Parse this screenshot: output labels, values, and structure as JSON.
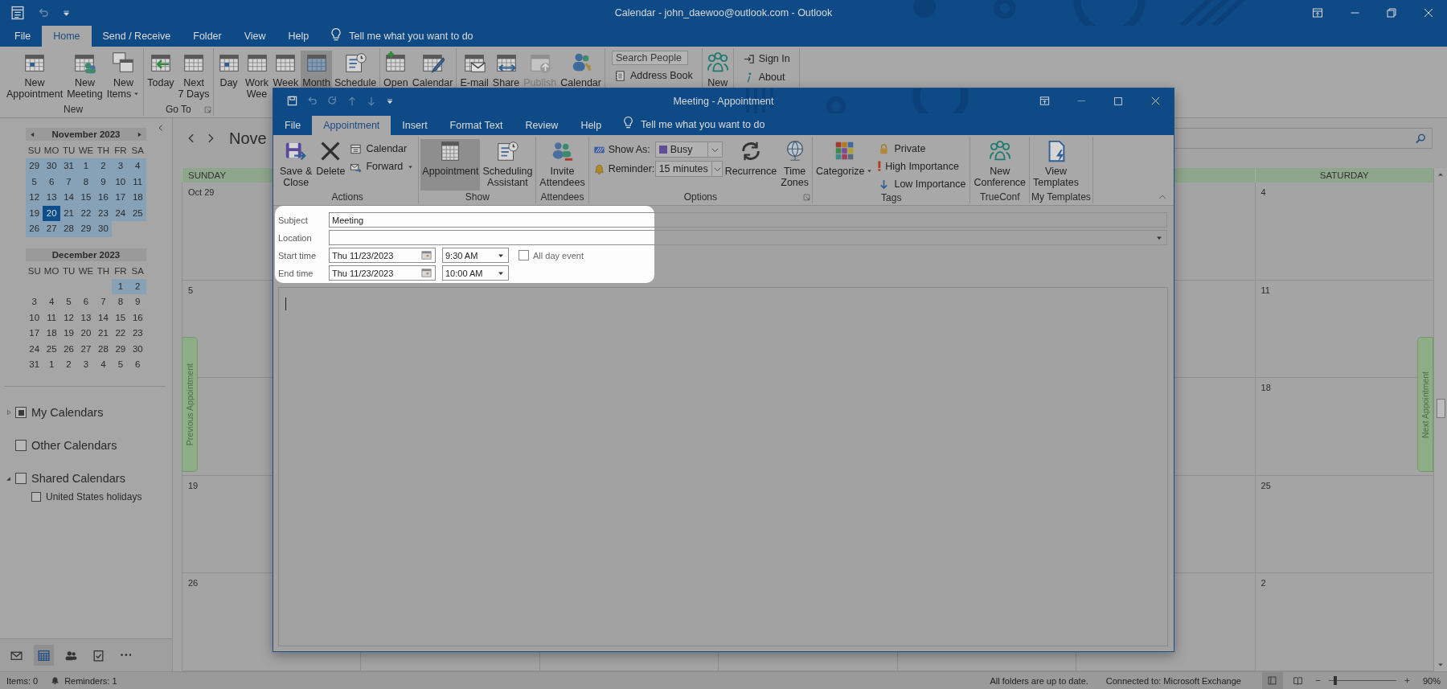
{
  "window": {
    "title": "Calendar - john_daewoo@outlook.com  -  Outlook"
  },
  "tabs": [
    {
      "label": "File",
      "selected": false
    },
    {
      "label": "Home",
      "selected": true
    },
    {
      "label": "Send / Receive",
      "selected": false
    },
    {
      "label": "Folder",
      "selected": false
    },
    {
      "label": "View",
      "selected": false
    },
    {
      "label": "Help",
      "selected": false
    }
  ],
  "tell_me": "Tell me what you want to do",
  "ribbon": {
    "groups": [
      {
        "kind": "large",
        "label": "New",
        "launcher": false,
        "buttons": [
          {
            "label": "New\nAppointment",
            "dropdown": false,
            "disabled": false,
            "selected": false
          },
          {
            "label": "New\nMeeting",
            "dropdown": false,
            "disabled": false,
            "selected": false
          },
          {
            "label": "New\nItems",
            "dropdown": true,
            "disabled": false,
            "selected": false
          }
        ]
      },
      {
        "kind": "large",
        "label": "Go To",
        "launcher": true,
        "buttons": [
          {
            "label": "Today",
            "dropdown": false,
            "disabled": false,
            "selected": false
          },
          {
            "label": "Next\n7 Days",
            "dropdown": false,
            "disabled": false,
            "selected": false
          }
        ]
      },
      {
        "kind": "large",
        "launcher": false,
        "buttons": [
          {
            "label": "Day",
            "dropdown": false,
            "disabled": false,
            "selected": false
          },
          {
            "label": "Work\nWee",
            "dropdown": false,
            "disabled": false,
            "selected": false
          },
          {
            "label": "Week",
            "dropdown": false,
            "disabled": false,
            "selected": false
          },
          {
            "label": "Month",
            "dropdown": false,
            "disabled": false,
            "selected": true
          },
          {
            "label": "Schedule",
            "dropdown": false,
            "disabled": false,
            "selected": false
          }
        ]
      },
      {
        "kind": "large",
        "launcher": false,
        "buttons": [
          {
            "label": "Open",
            "dropdown": false,
            "disabled": false,
            "selected": false
          },
          {
            "label": "Calendar",
            "dropdown": false,
            "disabled": false,
            "selected": false
          }
        ]
      },
      {
        "kind": "large",
        "launcher": false,
        "buttons": [
          {
            "label": "E-mail",
            "dropdown": false,
            "disabled": false,
            "selected": false
          },
          {
            "label": "Share",
            "dropdown": false,
            "disabled": false,
            "selected": false
          },
          {
            "label": "Publish",
            "dropdown": false,
            "disabled": true,
            "selected": false
          },
          {
            "label": "Calendar",
            "dropdown": false,
            "disabled": false,
            "selected": false
          }
        ]
      },
      {
        "kind": "find",
        "placeholder": "Search People",
        "button": "Address Book"
      },
      {
        "kind": "large",
        "launcher": false,
        "buttons": [
          {
            "label": "New",
            "dropdown": false,
            "disabled": false,
            "selected": false
          }
        ]
      },
      {
        "kind": "small",
        "buttons": [
          {
            "label": "Sign In"
          },
          {
            "label": "About"
          }
        ]
      }
    ]
  },
  "mini_calendars": [
    {
      "month": "November 2023",
      "arrows": true,
      "weekdays": [
        "SU",
        "MO",
        "TU",
        "WE",
        "TH",
        "FR",
        "SA"
      ],
      "weeks": [
        [
          {
            "day": "29",
            "in_view": true,
            "today": false
          },
          {
            "day": "30",
            "in_view": true,
            "today": false
          },
          {
            "day": "31",
            "in_view": true,
            "today": false
          },
          {
            "day": "1",
            "in_view": true,
            "today": false
          },
          {
            "day": "2",
            "in_view": true,
            "today": false
          },
          {
            "day": "3",
            "in_view": true,
            "today": false
          },
          {
            "day": "4",
            "in_view": true,
            "today": false
          }
        ],
        [
          {
            "day": "5",
            "in_view": true,
            "today": false
          },
          {
            "day": "6",
            "in_view": true,
            "today": false
          },
          {
            "day": "7",
            "in_view": true,
            "today": false
          },
          {
            "day": "8",
            "in_view": true,
            "today": false
          },
          {
            "day": "9",
            "in_view": true,
            "today": false
          },
          {
            "day": "10",
            "in_view": true,
            "today": false
          },
          {
            "day": "11",
            "in_view": true,
            "today": false
          }
        ],
        [
          {
            "day": "12",
            "in_view": true,
            "today": false
          },
          {
            "day": "13",
            "in_view": true,
            "today": false
          },
          {
            "day": "14",
            "in_view": true,
            "today": false
          },
          {
            "day": "15",
            "in_view": true,
            "today": false
          },
          {
            "day": "16",
            "in_view": true,
            "today": false
          },
          {
            "day": "17",
            "in_view": true,
            "today": false
          },
          {
            "day": "18",
            "in_view": true,
            "today": false
          }
        ],
        [
          {
            "day": "19",
            "in_view": true,
            "today": false
          },
          {
            "day": "20",
            "in_view": true,
            "today": true
          },
          {
            "day": "21",
            "in_view": true,
            "today": false
          },
          {
            "day": "22",
            "in_view": true,
            "today": false
          },
          {
            "day": "23",
            "in_view": true,
            "today": false
          },
          {
            "day": "24",
            "in_view": true,
            "today": false
          },
          {
            "day": "25",
            "in_view": true,
            "today": false
          }
        ],
        [
          {
            "day": "26",
            "in_view": true,
            "today": false
          },
          {
            "day": "27",
            "in_view": true,
            "today": false
          },
          {
            "day": "28",
            "in_view": true,
            "today": false
          },
          {
            "day": "29",
            "in_view": true,
            "today": false
          },
          {
            "day": "30",
            "in_view": true,
            "today": false
          }
        ]
      ]
    },
    {
      "month": "December 2023",
      "arrows": false,
      "weekdays": [
        "SU",
        "MO",
        "TU",
        "WE",
        "TH",
        "FR",
        "SA"
      ],
      "weeks": [
        [
          {
            "day": "1",
            "in_view": true,
            "today": false
          },
          {
            "day": "2",
            "in_view": true,
            "today": false
          }
        ],
        [
          {
            "day": "3",
            "in_view": false,
            "today": false
          },
          {
            "day": "4",
            "in_view": false,
            "today": false
          },
          {
            "day": "5",
            "in_view": false,
            "today": false
          },
          {
            "day": "6",
            "in_view": false,
            "today": false
          },
          {
            "day": "7",
            "in_view": false,
            "today": false
          },
          {
            "day": "8",
            "in_view": false,
            "today": false
          },
          {
            "day": "9",
            "in_view": false,
            "today": false
          }
        ],
        [
          {
            "day": "10",
            "in_view": false,
            "today": false
          },
          {
            "day": "11",
            "in_view": false,
            "today": false
          },
          {
            "day": "12",
            "in_view": false,
            "today": false
          },
          {
            "day": "13",
            "in_view": false,
            "today": false
          },
          {
            "day": "14",
            "in_view": false,
            "today": false
          },
          {
            "day": "15",
            "in_view": false,
            "today": false
          },
          {
            "day": "16",
            "in_view": false,
            "today": false
          }
        ],
        [
          {
            "day": "17",
            "in_view": false,
            "today": false
          },
          {
            "day": "18",
            "in_view": false,
            "today": false
          },
          {
            "day": "19",
            "in_view": false,
            "today": false
          },
          {
            "day": "20",
            "in_view": false,
            "today": false
          },
          {
            "day": "21",
            "in_view": false,
            "today": false
          },
          {
            "day": "22",
            "in_view": false,
            "today": false
          },
          {
            "day": "23",
            "in_view": false,
            "today": false
          }
        ],
        [
          {
            "day": "24",
            "in_view": false,
            "today": false
          },
          {
            "day": "25",
            "in_view": false,
            "today": false
          },
          {
            "day": "26",
            "in_view": false,
            "today": false
          },
          {
            "day": "27",
            "in_view": false,
            "today": false
          },
          {
            "day": "28",
            "in_view": false,
            "today": false
          },
          {
            "day": "29",
            "in_view": false,
            "today": false
          },
          {
            "day": "30",
            "in_view": false,
            "today": false
          }
        ],
        [
          {
            "day": "31",
            "in_view": false,
            "today": false
          },
          {
            "day": "1",
            "in_view": false,
            "today": false
          },
          {
            "day": "2",
            "in_view": false,
            "today": false
          },
          {
            "day": "3",
            "in_view": false,
            "today": false
          },
          {
            "day": "4",
            "in_view": false,
            "today": false
          },
          {
            "day": "5",
            "in_view": false,
            "today": false
          },
          {
            "day": "6",
            "in_view": false,
            "today": false
          }
        ]
      ]
    }
  ],
  "folders": [
    {
      "label": "My Calendars",
      "checked": true,
      "expandable": true,
      "expanded": false
    },
    {
      "label": "Other Calendars",
      "checked": false,
      "expandable": false
    },
    {
      "label": "Shared Calendars",
      "checked": false,
      "expandable": true,
      "expanded": true,
      "children": [
        {
          "label": "United States holidays",
          "checked": false
        }
      ]
    }
  ],
  "nav_items": [
    {
      "selected": false
    },
    {
      "selected": true
    },
    {
      "selected": false
    },
    {
      "selected": false
    },
    {
      "selected": false
    }
  ],
  "calendar": {
    "month_label": "Nove",
    "headers": {
      "sunday": "SUNDAY",
      "saturday": "SATURDAY"
    },
    "weeks": [
      {
        "sunday": "Oct 29",
        "saturday": "4"
      },
      {
        "sunday": "5",
        "saturday": "11"
      },
      {
        "saturday": "18"
      },
      {
        "sunday": "19",
        "saturday": "25"
      },
      {
        "sunday": "26",
        "saturday": "2"
      }
    ],
    "previous_tab": "Previous Appointment",
    "next_tab": "Next Appointment"
  },
  "appointment": {
    "title": "Meeting  -  Appointment",
    "tabs": [
      {
        "label": "File",
        "selected": false
      },
      {
        "label": "Appointment",
        "selected": true
      },
      {
        "label": "Insert",
        "selected": false
      },
      {
        "label": "Format Text",
        "selected": false
      },
      {
        "label": "Review",
        "selected": false
      },
      {
        "label": "Help",
        "selected": false
      }
    ],
    "tell_me": "Tell me what you want to do",
    "ribbon": {
      "groups": [
        {
          "label": "Actions",
          "launcher": false,
          "items": [
            {
              "kind": "large",
              "label": "Save &\nClose",
              "dropdown": false,
              "selected": false
            },
            {
              "kind": "large",
              "label": "Delete",
              "dropdown": false,
              "selected": false
            },
            {
              "kind": "small",
              "label": "Calendar",
              "dropdown": false
            },
            {
              "kind": "small",
              "label": "Forward",
              "dropdown": true
            }
          ]
        },
        {
          "label": "Show",
          "launcher": false,
          "items": [
            {
              "kind": "large",
              "label": "Appointment",
              "dropdown": false,
              "selected": true
            },
            {
              "kind": "large",
              "label": "Scheduling\nAssistant",
              "dropdown": false,
              "selected": false
            }
          ]
        },
        {
          "label": "Attendees",
          "launcher": false,
          "items": [
            {
              "kind": "large",
              "label": "Invite\nAttendees",
              "dropdown": false,
              "selected": false
            }
          ]
        },
        {
          "label": "Options",
          "launcher": true,
          "items": [
            {
              "kind": "select",
              "label": "Show As:",
              "value": "Busy",
              "swatch": true
            },
            {
              "kind": "select",
              "label": "Reminder:",
              "value": "15 minutes",
              "swatch": false
            },
            {
              "kind": "large",
              "label": "Recurrence",
              "dropdown": false,
              "selected": false
            },
            {
              "kind": "large",
              "label": "Time\nZones",
              "dropdown": false,
              "selected": false
            }
          ]
        },
        {
          "label": "Tags",
          "launcher": false,
          "items": [
            {
              "kind": "large",
              "label": "Categorize",
              "dropdown": true,
              "selected": false
            },
            {
              "kind": "small",
              "label": "Private",
              "dropdown": false
            },
            {
              "kind": "small",
              "label": "High Importance",
              "dropdown": false
            },
            {
              "kind": "small",
              "label": "Low Importance",
              "dropdown": false
            }
          ]
        },
        {
          "label": "TrueConf",
          "launcher": false,
          "items": [
            {
              "kind": "large",
              "label": "New\nConference",
              "dropdown": false,
              "selected": false
            }
          ]
        },
        {
          "label": "My Templates",
          "launcher": false,
          "items": [
            {
              "kind": "large",
              "label": "View\nTemplates",
              "dropdown": false,
              "selected": false
            }
          ]
        }
      ]
    },
    "form": {
      "subject": {
        "label": "Subject",
        "value": "Meeting"
      },
      "location": {
        "label": "Location"
      },
      "start": {
        "label": "Start time",
        "date": "Thu 11/23/2023",
        "time": "9:30 AM"
      },
      "all_day": {
        "label": "All day event",
        "checked": false
      },
      "end": {
        "label": "End time",
        "date": "Thu 11/23/2023",
        "time": "10:00 AM"
      }
    }
  },
  "status_bar": {
    "items": "Items: 0",
    "reminders": "Reminders: 1",
    "sync": "All folders are up to date.",
    "connection": "Connected to: Microsoft Exchange",
    "views": [
      {
        "selected": true
      },
      {
        "selected": false
      }
    ],
    "zoom": {
      "level": 0.1,
      "reading": "90%"
    }
  }
}
